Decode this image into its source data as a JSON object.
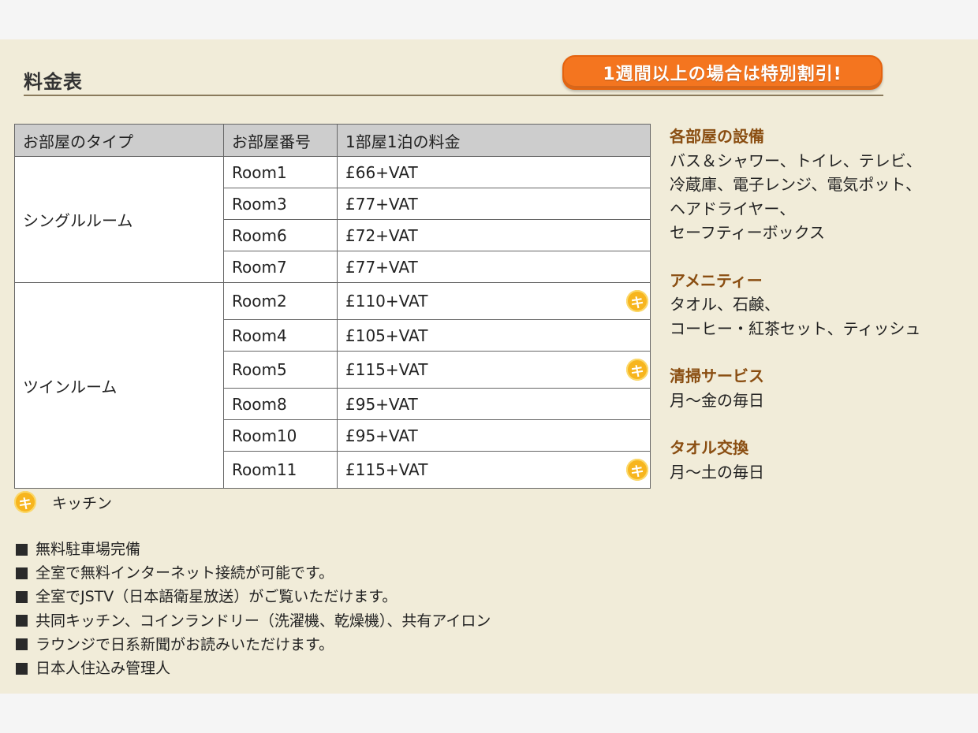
{
  "header": {
    "title": "料金表",
    "promo": "1週間以上の場合は特別割引!"
  },
  "colors": {
    "panel_bg": "#f1ecd9",
    "promo": "#f4751f",
    "heading": "#8a4e12",
    "kitchen_badge": "#f7b51e"
  },
  "table": {
    "headers": [
      "お部屋のタイプ",
      "お部屋番号",
      "1部屋1泊の料金"
    ],
    "groups": [
      {
        "type": "シングルルーム",
        "rooms": [
          {
            "room": "Room1",
            "price": "£66+VAT",
            "kitchen": false
          },
          {
            "room": "Room3",
            "price": "£77+VAT",
            "kitchen": false
          },
          {
            "room": "Room6",
            "price": "£72+VAT",
            "kitchen": false
          },
          {
            "room": "Room7",
            "price": "£77+VAT",
            "kitchen": false
          }
        ]
      },
      {
        "type": "ツインルーム",
        "rooms": [
          {
            "room": "Room2",
            "price": "£110+VAT",
            "kitchen": true
          },
          {
            "room": "Room4",
            "price": "£105+VAT",
            "kitchen": false
          },
          {
            "room": "Room5",
            "price": "£115+VAT",
            "kitchen": true
          },
          {
            "room": "Room8",
            "price": "£95+VAT",
            "kitchen": false
          },
          {
            "room": "Room10",
            "price": "£95+VAT",
            "kitchen": false
          },
          {
            "room": "Room11",
            "price": "£115+VAT",
            "kitchen": true
          }
        ]
      }
    ]
  },
  "legend": {
    "badge": "キ",
    "label": "キッチン"
  },
  "notes": [
    "無料駐車場完備",
    "全室で無料インターネット接続が可能です。",
    "全室でJSTV（日本語衛星放送）がご覧いただけます。",
    "共同キッチン、コインランドリー（洗濯機、乾燥機）、共有アイロン",
    "ラウンジで日系新聞がお読みいただけます。",
    "日本人住込み管理人"
  ],
  "side": [
    {
      "heading": "各部屋の設備",
      "lines": [
        "バス＆シャワー、トイレ、テレビ、",
        "冷蔵庫、電子レンジ、電気ポット、",
        "ヘアドライヤー、",
        "セーフティーボックス"
      ]
    },
    {
      "heading": "アメニティー",
      "lines": [
        "タオル、石鹸、",
        "コーヒー・紅茶セット、ティッシュ"
      ]
    },
    {
      "heading": "清掃サービス",
      "lines": [
        "月～金の毎日"
      ]
    },
    {
      "heading": "タオル交換",
      "lines": [
        "月～土の毎日"
      ]
    }
  ]
}
